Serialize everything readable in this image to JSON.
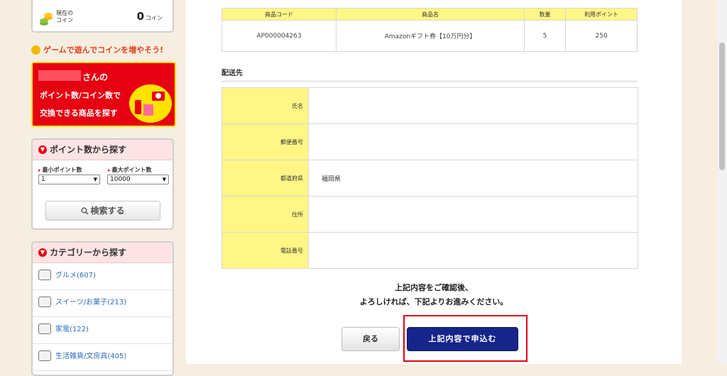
{
  "sidebar": {
    "coin": {
      "label_line1": "現在の",
      "label_line2": "コイン",
      "amount": "0",
      "unit": "コイン"
    },
    "game_link": "ゲームで遊んでコインを増やそう!",
    "banner": {
      "suffix": "さんの",
      "line1": "ポイント数/コイン数で",
      "line2": "交換できる商品を探す"
    },
    "point_search": {
      "title": "ポイント数から探す",
      "min_label": "最小ポイント数",
      "max_label": "最大ポイント数",
      "min_value": "1",
      "max_value": "10000",
      "button": "検索する"
    },
    "category": {
      "title": "カテゴリーから探す",
      "items": [
        {
          "label": "グルメ(607)",
          "icon": "food-icon"
        },
        {
          "label": "スイーツ/お菓子(213)",
          "icon": "cake-icon"
        },
        {
          "label": "家電(122)",
          "icon": "tv-icon"
        },
        {
          "label": "生活雑貨/文房具(405)",
          "icon": "stationery-icon"
        }
      ]
    }
  },
  "order": {
    "headers": [
      "商品コード",
      "商品名",
      "数量",
      "利用ポイント"
    ],
    "row": {
      "code": "AP000004263",
      "name": "Amazonギフト券【10万円分】",
      "qty": "5",
      "points": "250"
    }
  },
  "shipping": {
    "title": "配送先",
    "fields": [
      {
        "label": "氏名",
        "value": ""
      },
      {
        "label": "郵便番号",
        "value": ""
      },
      {
        "label": "都道府県",
        "value": "福岡県"
      },
      {
        "label": "住所",
        "value": ""
      },
      {
        "label": "電話番号",
        "value": ""
      }
    ]
  },
  "confirm": {
    "line1": "上記内容をご確認後、",
    "line2": "よろしければ、下記よりお進みください。",
    "back_button": "戻る",
    "submit_button": "上記内容で申込む"
  },
  "colors": {
    "accent": "#e60012",
    "submit": "#15258a",
    "table_header": "#fff685",
    "background": "#f6efe1"
  }
}
